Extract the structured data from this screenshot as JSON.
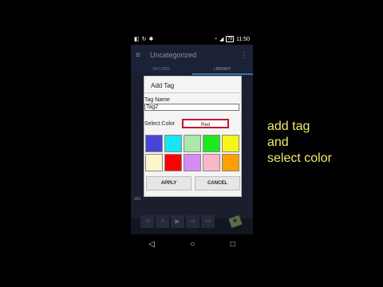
{
  "status_bar": {
    "battery": "78",
    "time": "11:50"
  },
  "app_bar": {
    "title": "Uncategorized"
  },
  "tabs": [
    {
      "label": "RECORD"
    },
    {
      "label": "LIBRARY"
    }
  ],
  "background": {
    "partial_text": "201"
  },
  "dialog": {
    "title": "Add Tag",
    "name_label": "Tag Name",
    "name_value": "Tag2",
    "color_label": "Select Color",
    "color_value": "Red",
    "swatches": [
      "#4646d6",
      "#18e6f3",
      "#a9e8a8",
      "#1ee81e",
      "#f5f51a",
      "#fbf7c9",
      "#ff0000",
      "#d58cf2",
      "#f7b7c9",
      "#ff9f00"
    ],
    "apply_label": "APPLY",
    "cancel_label": "CANCEL"
  },
  "player_controls": [
    "-10",
    "-5",
    "+5",
    "+10"
  ],
  "caption": {
    "line1": "add tag",
    "line2": "and",
    "line3": "select color"
  }
}
